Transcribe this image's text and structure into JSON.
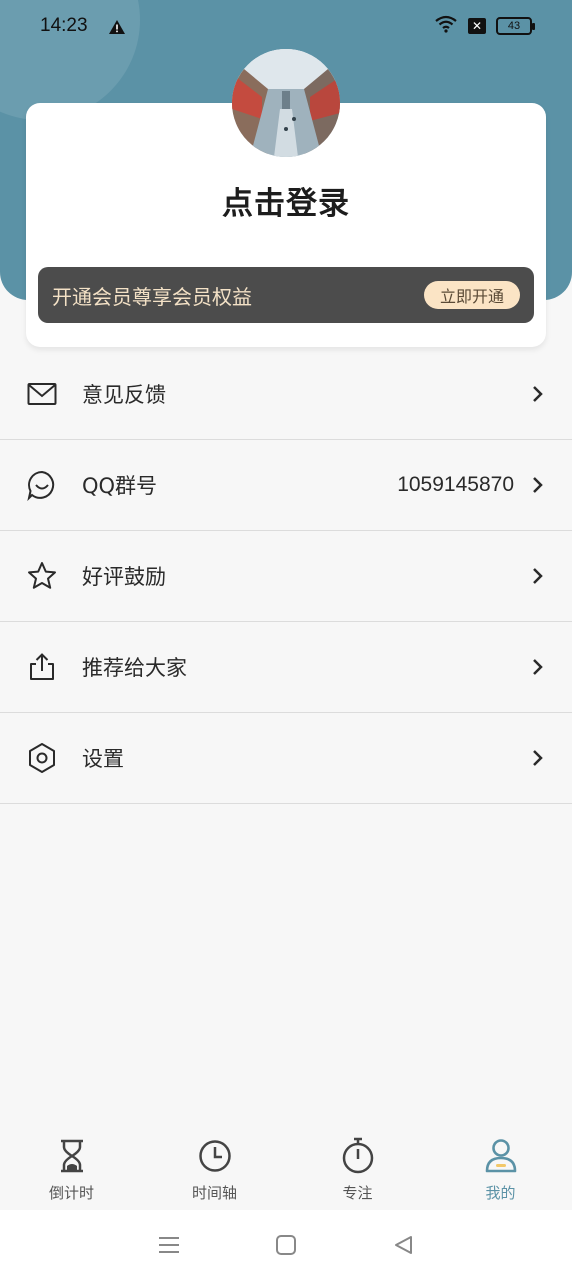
{
  "status_bar": {
    "time": "14:23",
    "battery": "43"
  },
  "colors": {
    "accent": "#5b92a6",
    "vip_bar": "#4c4c4c",
    "vip_button": "#fbe4c5"
  },
  "profile": {
    "login_prompt": "点击登录",
    "avatar_icon": "street-photo-avatar"
  },
  "vip": {
    "text": "开通会员尊享会员权益",
    "button_label": "立即开通"
  },
  "menu": {
    "items": [
      {
        "icon": "mail-icon",
        "label": "意见反馈"
      },
      {
        "icon": "chat-bubble-icon",
        "label": "QQ群号",
        "value": "1059145870"
      },
      {
        "icon": "star-icon",
        "label": "好评鼓励"
      },
      {
        "icon": "share-icon",
        "label": "推荐给大家"
      },
      {
        "icon": "hexagon-settings-icon",
        "label": "设置"
      }
    ]
  },
  "tabbar": {
    "tabs": [
      {
        "icon": "hourglass-icon",
        "label": "倒计时"
      },
      {
        "icon": "clock-icon",
        "label": "时间轴"
      },
      {
        "icon": "stopwatch-icon",
        "label": "专注"
      },
      {
        "icon": "person-icon",
        "label": "我的",
        "active": true
      }
    ]
  }
}
